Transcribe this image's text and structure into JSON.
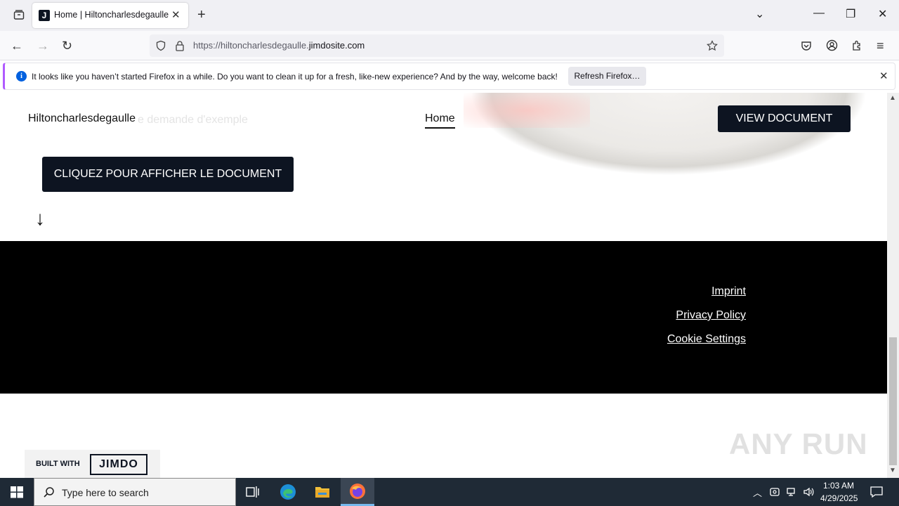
{
  "browser": {
    "tab_title": "Home | Hiltoncharlesdegaulle",
    "tab_favicon_letter": "J",
    "url_prefix": "https://hiltoncharlesdegaulle.",
    "url_domain": "jimdosite.com",
    "notification_text": "It looks like you haven’t started Firefox in a while. Do you want to clean it up for a fresh, like-new experience? And by the way, welcome back!",
    "notification_button": "Refresh Firefox…",
    "accent_color": "#b05aff"
  },
  "site": {
    "name": "Hiltoncharlesdegaulle",
    "ghost_text": "e demande d'exemple",
    "nav_home": "Home",
    "view_document_button": "VIEW DOCUMENT",
    "cta_button": "CLIQUEZ POUR AFFICHER LE DOCUMENT",
    "arrow": "↓",
    "footer_links": [
      "Imprint",
      "Privacy Policy",
      "Cookie Settings"
    ],
    "built_with": "BUILT WITH",
    "jimdo_logo": "JIMDO",
    "brand_dark": "#0d1421"
  },
  "watermark": "ANY RUN",
  "taskbar": {
    "search_placeholder": "Type here to search",
    "time": "1:03 AM",
    "date": "4/29/2025"
  }
}
